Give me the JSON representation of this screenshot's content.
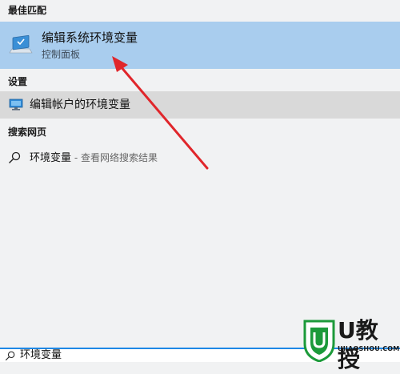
{
  "sections": {
    "best_match": "最佳匹配",
    "settings": "设置",
    "web_search": "搜索网页"
  },
  "best_match_item": {
    "title": "编辑系统环境变量",
    "subtitle": "控制面板",
    "icon": "computer-icon"
  },
  "settings_item": {
    "label": "编辑帐户的环境变量",
    "icon": "monitor-icon"
  },
  "web_item": {
    "query": "环境变量",
    "hint": " - 查看网络搜索结果",
    "icon": "search-icon"
  },
  "search_box": {
    "value": "环境变量",
    "icon": "search-icon"
  },
  "watermark": {
    "brand": "U教授",
    "url": "UJIAOSHOU.COM"
  },
  "colors": {
    "highlight": "#a9cdee",
    "settings_row": "#d9d9d9",
    "arrow": "#e0262b",
    "accent": "#1e88e5",
    "logo_green": "#1c9a3a"
  }
}
